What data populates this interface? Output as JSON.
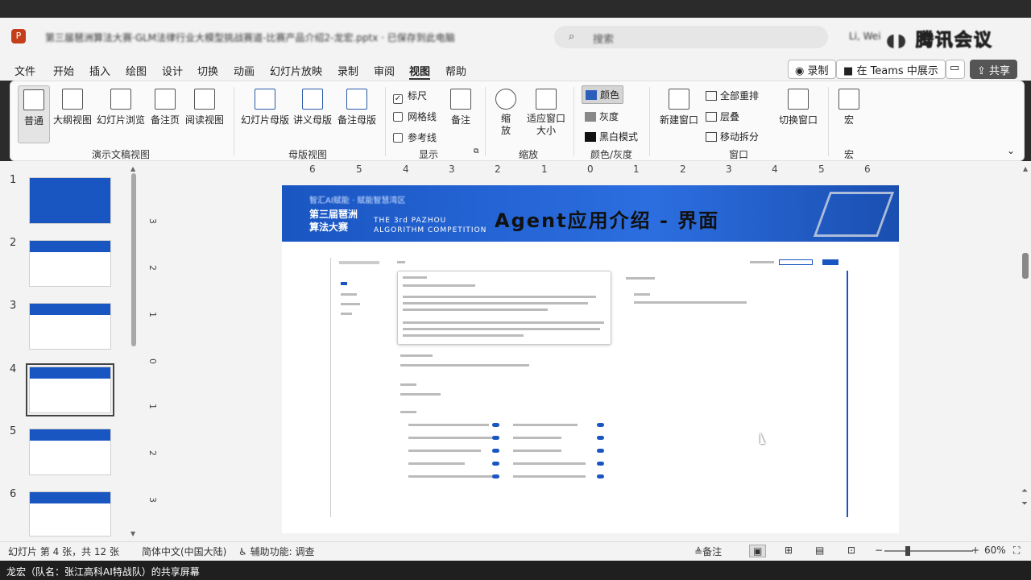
{
  "window": {
    "title": "第三届琶洲算法大赛·GLM法律行业大模型挑战赛道-比赛产品介绍2-龙宏.pptx · 已保存到此电脑",
    "search_placeholder": "搜索",
    "user": "Li, Wei",
    "brand": "腾讯会议"
  },
  "menu": {
    "items": [
      "文件",
      "开始",
      "插入",
      "绘图",
      "设计",
      "切换",
      "动画",
      "幻灯片放映",
      "录制",
      "审阅",
      "视图",
      "帮助"
    ],
    "active": "视图",
    "record_button": "录制",
    "teams_button": "在 Teams 中展示",
    "share_button": "共享"
  },
  "ribbon": {
    "views": {
      "normal": "普通",
      "outline": "大纲视图",
      "sorter": "幻灯片浏览",
      "notes_page": "备注页",
      "reading": "阅读视图",
      "group": "演示文稿视图"
    },
    "masters": {
      "slide_master": "幻灯片母版",
      "handout_master": "讲义母版",
      "notes_master": "备注母版",
      "group": "母版视图"
    },
    "show": {
      "ruler": "标尺",
      "gridlines": "网格线",
      "guides": "参考线",
      "notes": "备注",
      "group": "显示"
    },
    "zoom": {
      "zoom": "缩放",
      "fit": "适应窗口大小",
      "group": "缩放"
    },
    "color": {
      "color": "颜色",
      "grayscale": "灰度",
      "bw": "黑白模式",
      "group": "颜色/灰度"
    },
    "window": {
      "new_window": "新建窗口",
      "arrange_all": "全部重排",
      "cascade": "层叠",
      "move_split": "移动拆分",
      "switch": "切换窗口",
      "group": "窗口"
    },
    "macro": {
      "macro": "宏",
      "group": "宏"
    }
  },
  "thumbnails": {
    "numbers": [
      "1",
      "2",
      "3",
      "4",
      "5",
      "6"
    ],
    "selected": 4
  },
  "ruler_top": [
    "6",
    "5",
    "4",
    "3",
    "2",
    "1",
    "0",
    "1",
    "2",
    "3",
    "4",
    "5",
    "6"
  ],
  "ruler_left": [
    "3",
    "2",
    "1",
    "0",
    "1",
    "2",
    "3"
  ],
  "slide": {
    "banner_sub": "智汇AI赋能 · 赋能智慧湾区",
    "banner_left": [
      "第三届琶洲",
      "算法大赛"
    ],
    "banner_mid": [
      "THE 3rd PAZHOU",
      "ALGORITHM COMPETITION"
    ],
    "banner_title": "Agent应用介绍 - 界面"
  },
  "status": {
    "slide_info": "幻灯片 第 4 张，共 12 张",
    "language": "简体中文(中国大陆)",
    "accessibility": "辅助功能: 调查",
    "notes": "备注",
    "zoom": "60%"
  },
  "share_bar": "龙宏（队名：张江高科AI特战队）的共享屏幕"
}
